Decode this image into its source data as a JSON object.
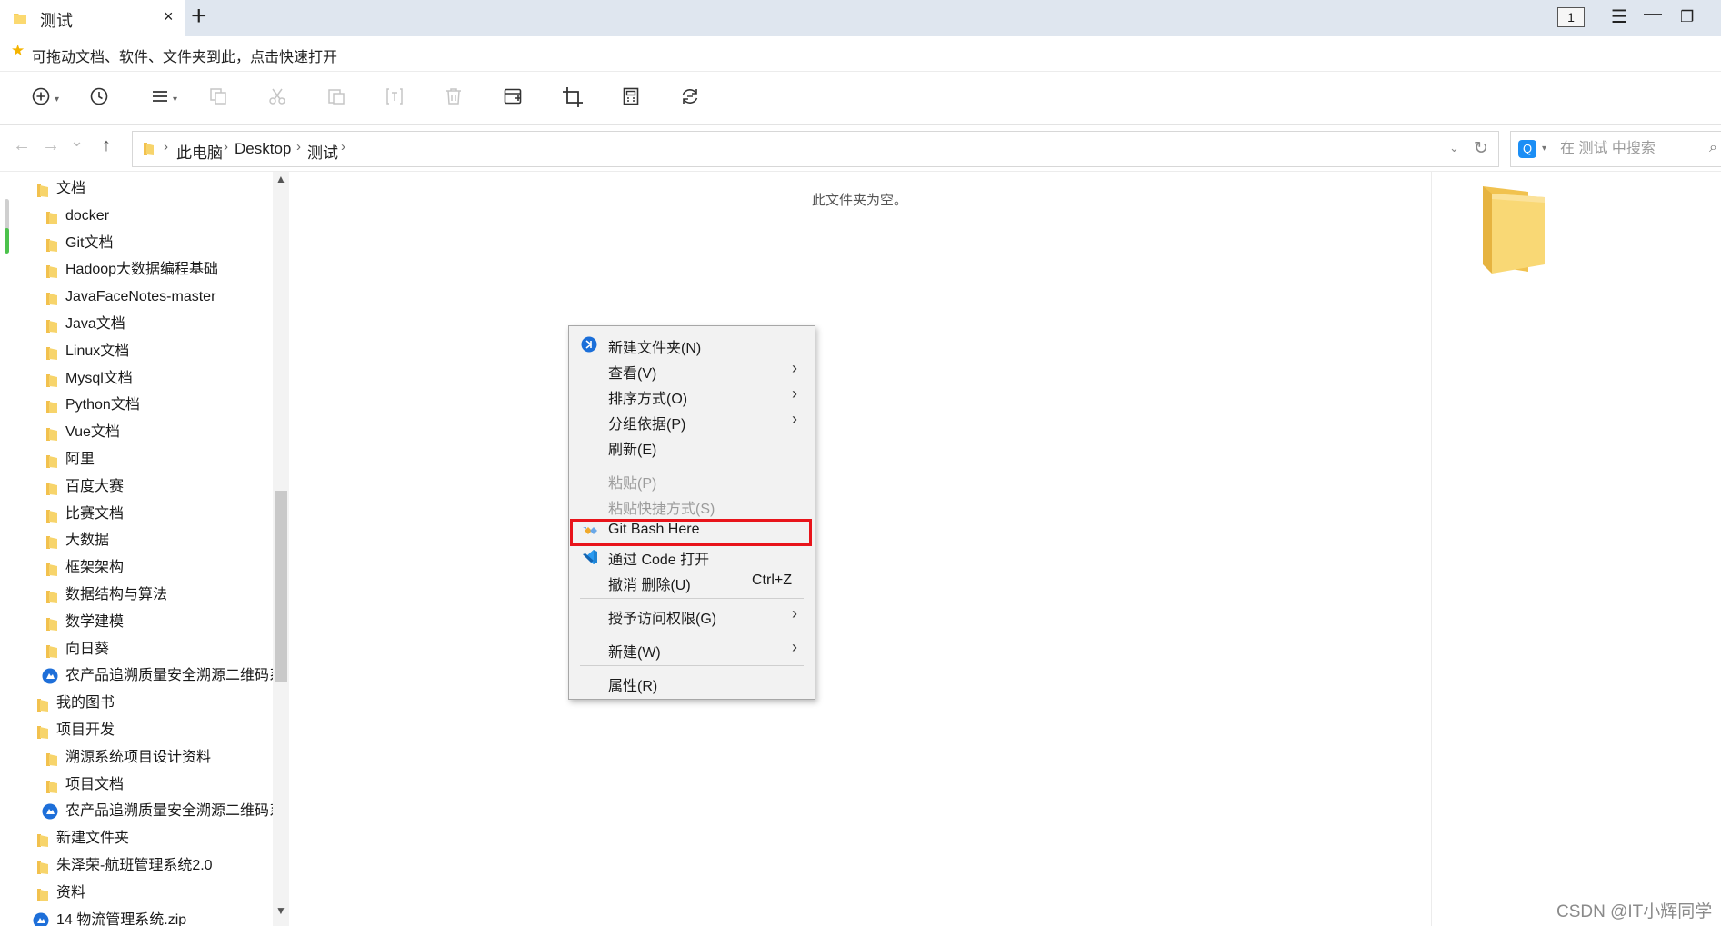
{
  "tabbar": {
    "tab_title": "测试",
    "tab_close": "×",
    "new_tab": "+",
    "tab_count": "1",
    "menu_glyph": "☰",
    "minimize_glyph": "—",
    "restore_glyph": "❐"
  },
  "quickbar": {
    "icon": "star-icon",
    "text": "可拖动文档、软件、文件夹到此，点击快速打开"
  },
  "toolbar": {
    "buttons": [
      {
        "icon": "new-icon",
        "enabled": true
      },
      {
        "icon": "history-icon",
        "enabled": true
      },
      {
        "icon": "view-icon",
        "enabled": true
      },
      {
        "icon": "copy-icon",
        "enabled": false
      },
      {
        "icon": "cut-icon",
        "enabled": false
      },
      {
        "icon": "paste-icon",
        "enabled": false
      },
      {
        "icon": "rename-icon",
        "enabled": false
      },
      {
        "icon": "delete-icon",
        "enabled": false
      },
      {
        "icon": "new-window-icon",
        "enabled": true
      },
      {
        "icon": "crop-icon",
        "enabled": true
      },
      {
        "icon": "calculator-icon",
        "enabled": true
      },
      {
        "icon": "refresh-icon",
        "enabled": true
      }
    ]
  },
  "nav": {
    "back": "←",
    "forward": "→",
    "history": "⌄",
    "up": "↑",
    "breadcrumb": [
      "此电脑",
      "Desktop",
      "测试"
    ],
    "dropdown": "⌄",
    "refresh": "↻"
  },
  "search": {
    "engine_glyph": "Q",
    "placeholder": "在 测试 中搜索"
  },
  "sidebar": {
    "items": [
      {
        "label": "文档",
        "level": 0,
        "icon": "folder-icon"
      },
      {
        "label": "docker",
        "level": 1,
        "icon": "folder-icon"
      },
      {
        "label": "Git文档",
        "level": 1,
        "icon": "folder-icon"
      },
      {
        "label": "Hadoop大数据编程基础",
        "level": 1,
        "icon": "folder-icon"
      },
      {
        "label": "JavaFaceNotes-master",
        "level": 1,
        "icon": "folder-icon"
      },
      {
        "label": "Java文档",
        "level": 1,
        "icon": "folder-icon"
      },
      {
        "label": "Linux文档",
        "level": 1,
        "icon": "folder-icon"
      },
      {
        "label": "Mysql文档",
        "level": 1,
        "icon": "folder-icon"
      },
      {
        "label": "Python文档",
        "level": 1,
        "icon": "folder-icon"
      },
      {
        "label": "Vue文档",
        "level": 1,
        "icon": "folder-icon"
      },
      {
        "label": "阿里",
        "level": 1,
        "icon": "folder-icon"
      },
      {
        "label": "百度大赛",
        "level": 1,
        "icon": "folder-icon"
      },
      {
        "label": "比赛文档",
        "level": 1,
        "icon": "folder-icon"
      },
      {
        "label": "大数据",
        "level": 1,
        "icon": "folder-icon"
      },
      {
        "label": "框架架构",
        "level": 1,
        "icon": "folder-icon"
      },
      {
        "label": "数据结构与算法",
        "level": 1,
        "icon": "folder-icon"
      },
      {
        "label": "数学建模",
        "level": 1,
        "icon": "folder-icon"
      },
      {
        "label": "向日葵",
        "level": 1,
        "icon": "folder-icon"
      },
      {
        "label": "农产品追溯质量安全溯源二维码系",
        "level": 1,
        "icon": "app-shortcut-icon"
      },
      {
        "label": "我的图书",
        "level": 0,
        "icon": "folder-icon"
      },
      {
        "label": "项目开发",
        "level": 0,
        "icon": "folder-icon"
      },
      {
        "label": "溯源系统项目设计资料",
        "level": 1,
        "icon": "folder-icon"
      },
      {
        "label": "项目文档",
        "level": 1,
        "icon": "folder-icon"
      },
      {
        "label": "农产品追溯质量安全溯源二维码系",
        "level": 1,
        "icon": "app-shortcut-icon"
      },
      {
        "label": "新建文件夹",
        "level": 0,
        "icon": "folder-icon"
      },
      {
        "label": "朱泽荣-航班管理系统2.0",
        "level": 0,
        "icon": "folder-icon"
      },
      {
        "label": "资料",
        "level": 0,
        "icon": "folder-icon"
      },
      {
        "label": "14 物流管理系统.zip",
        "level": 0,
        "icon": "app-shortcut-icon"
      }
    ]
  },
  "content": {
    "empty_message": "此文件夹为空。"
  },
  "context_menu": {
    "items": [
      {
        "type": "item",
        "label": "新建文件夹(N)",
        "icon": "new-folder-icon"
      },
      {
        "type": "item",
        "label": "查看(V)",
        "submenu": true
      },
      {
        "type": "item",
        "label": "排序方式(O)",
        "submenu": true
      },
      {
        "type": "item",
        "label": "分组依据(P)",
        "submenu": true
      },
      {
        "type": "item",
        "label": "刷新(E)"
      },
      {
        "type": "separator"
      },
      {
        "type": "item",
        "label": "粘贴(P)",
        "disabled": true
      },
      {
        "type": "item",
        "label": "粘贴快捷方式(S)",
        "disabled": true
      },
      {
        "type": "separator-hidden"
      },
      {
        "type": "item",
        "label": "Git Bash Here",
        "icon": "git-icon",
        "highlighted": true
      },
      {
        "type": "item",
        "label": "通过 Code 打开",
        "icon": "vscode-icon"
      },
      {
        "type": "item",
        "label": "撤消 删除(U)",
        "shortcut": "Ctrl+Z"
      },
      {
        "type": "separator"
      },
      {
        "type": "item",
        "label": "授予访问权限(G)",
        "submenu": true
      },
      {
        "type": "separator"
      },
      {
        "type": "item",
        "label": "新建(W)",
        "submenu": true
      },
      {
        "type": "separator"
      },
      {
        "type": "item",
        "label": "属性(R)"
      }
    ]
  },
  "colors": {
    "accent_blue": "#1b8ef5",
    "highlight_red": "#e8141b",
    "folder_yellow": "#f7cf5b",
    "tabbar_bg": "#dfe6ef"
  },
  "watermark": "CSDN @IT小辉同学"
}
